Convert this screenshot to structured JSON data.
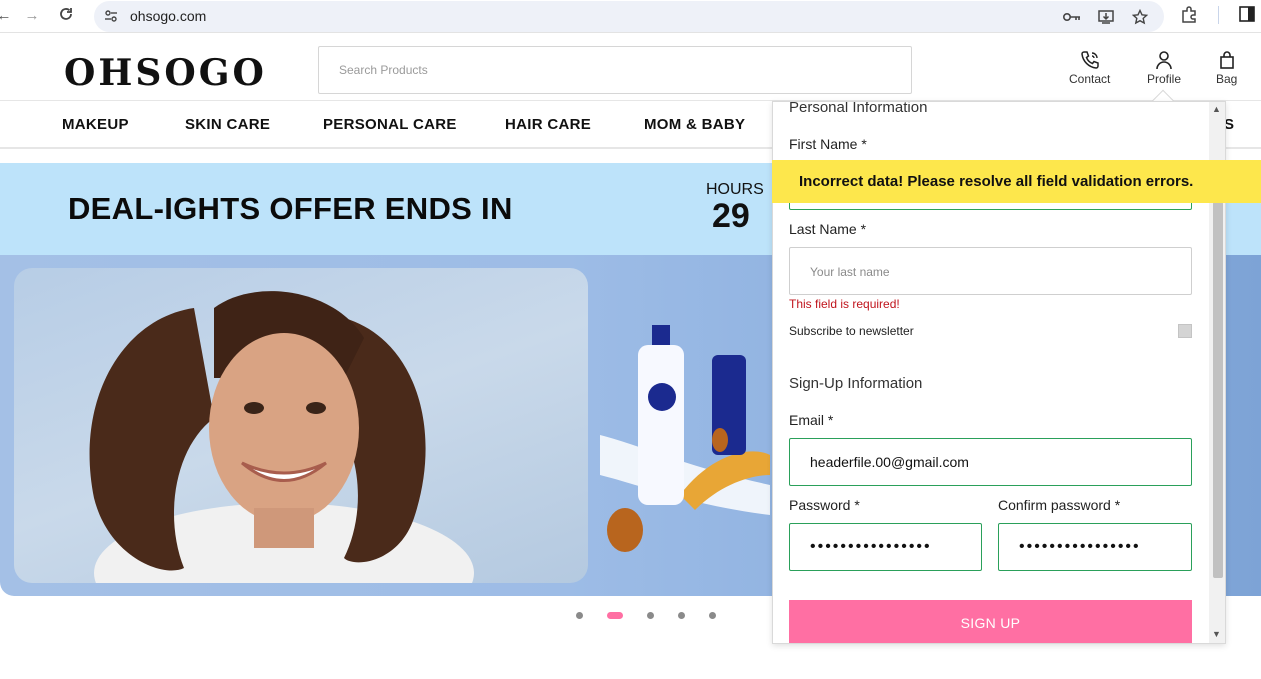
{
  "browser": {
    "url": "ohsogo.com"
  },
  "header": {
    "logo": "OHSOGO",
    "search_placeholder": "Search Products",
    "contact_label": "Contact",
    "profile_label": "Profile",
    "bag_label": "Bag"
  },
  "categories": [
    "MAKEUP",
    "SKIN CARE",
    "PERSONAL CARE",
    "HAIR CARE",
    "MOM & BABY",
    "S"
  ],
  "deal": {
    "title": "DEAL-IGHTS OFFER ENDS IN",
    "hours_label": "HOURS",
    "hours_value": "29"
  },
  "carousel": {
    "slide_count": 5,
    "active_index": 1
  },
  "panel": {
    "personal_title": "Personal Information",
    "first_name_label": "First Name *",
    "last_name_label": "Last Name *",
    "last_name_placeholder": "Your last name",
    "error_text": "This field is required!",
    "subscribe_label": "Subscribe to newsletter",
    "signup_title": "Sign-Up Information",
    "email_label": "Email *",
    "email_value": "headerfile.00@gmail.com",
    "password_label": "Password *",
    "password_value": "••••••••••••••••",
    "confirm_label": "Confirm password *",
    "confirm_value": "••••••••••••••••",
    "signup_button": "SIGN UP"
  },
  "toast": {
    "message": "Incorrect data! Please resolve all field validation errors."
  },
  "colors": {
    "accent_pink": "#ff6fa3",
    "toast_yellow": "#fde74c",
    "banner_blue": "#bde3fa",
    "valid_green": "#2aa05a",
    "error_red": "#c0141c"
  }
}
